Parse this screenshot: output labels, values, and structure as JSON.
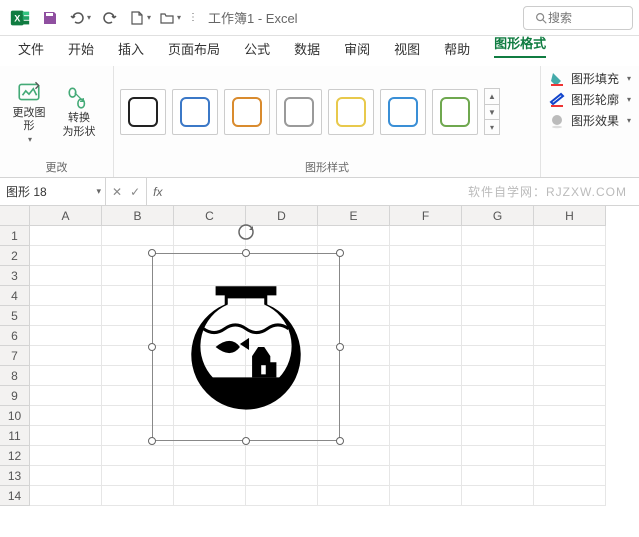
{
  "title": "工作簿1 - Excel",
  "search": {
    "placeholder": "搜索"
  },
  "tabs": {
    "file": "文件",
    "home": "开始",
    "insert": "插入",
    "layout": "页面布局",
    "formulas": "公式",
    "data": "数据",
    "review": "审阅",
    "view": "视图",
    "help": "帮助",
    "shapeformat": "图形格式"
  },
  "ribbon": {
    "change_group": "更改",
    "change_graphic": "更改图\n形",
    "convert_shape": "转换\n为形状",
    "styles_group": "图形样式",
    "fill": "图形填充",
    "outline": "图形轮廓",
    "effects": "图形效果",
    "style_colors": [
      "#222222",
      "#3b78c7",
      "#d98b2e",
      "#9a9a9a",
      "#e8c94c",
      "#3a8fd6",
      "#6fa84f"
    ]
  },
  "namebox": {
    "value": "图形 18"
  },
  "watermark": "软件自学网：RJZXW.COM",
  "columns": [
    "A",
    "B",
    "C",
    "D",
    "E",
    "F",
    "G",
    "H"
  ],
  "rows": [
    "1",
    "2",
    "3",
    "4",
    "5",
    "6",
    "7",
    "8",
    "9",
    "10",
    "11",
    "12",
    "13",
    "14"
  ]
}
